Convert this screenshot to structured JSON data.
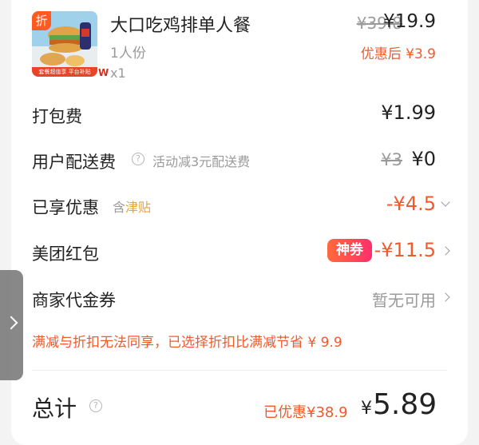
{
  "product": {
    "discount_tag": "折",
    "image_banner_text": "套餐超值享 平台补贴",
    "image_mark": "W",
    "name": "大口吃鸡排单人餐",
    "spec": "1人份",
    "quantity": "x1",
    "original_price": "¥39.8",
    "current_price": "¥19.9",
    "after_discount_price": "优惠后 ¥3.9"
  },
  "packaging": {
    "label": "打包费",
    "value": "¥1.99"
  },
  "delivery": {
    "label": "用户配送费",
    "info_icon": "?",
    "note": "活动减3元配送费",
    "original_value": "¥3",
    "value": "¥0"
  },
  "discount": {
    "label": "已享优惠",
    "note_prefix": "含",
    "note_link": "津贴",
    "value": "-¥4.5"
  },
  "red_packet": {
    "label": "美团红包",
    "badge": "神券",
    "value": "-¥11.5"
  },
  "merchant_coupon": {
    "label": "商家代金券",
    "value": "暂无可用"
  },
  "notice": "满减与折扣无法同享，已选择折扣比满减节省 ¥ 9.9",
  "total": {
    "label": "总计",
    "info_icon": "?",
    "saved": "已优惠¥38.9",
    "currency": "¥",
    "amount": "5.89"
  },
  "colors": {
    "accent": "#f15a2b",
    "badge_start": "#ff6a3a",
    "badge_end": "#ff2f6a",
    "jintie": "#e8a23a"
  },
  "icons": {
    "side_handle": "chevron-right-icon",
    "row_arrow": "chevron-right-icon",
    "discount_arrow": "chevron-down-icon",
    "info": "question-circle-icon"
  }
}
